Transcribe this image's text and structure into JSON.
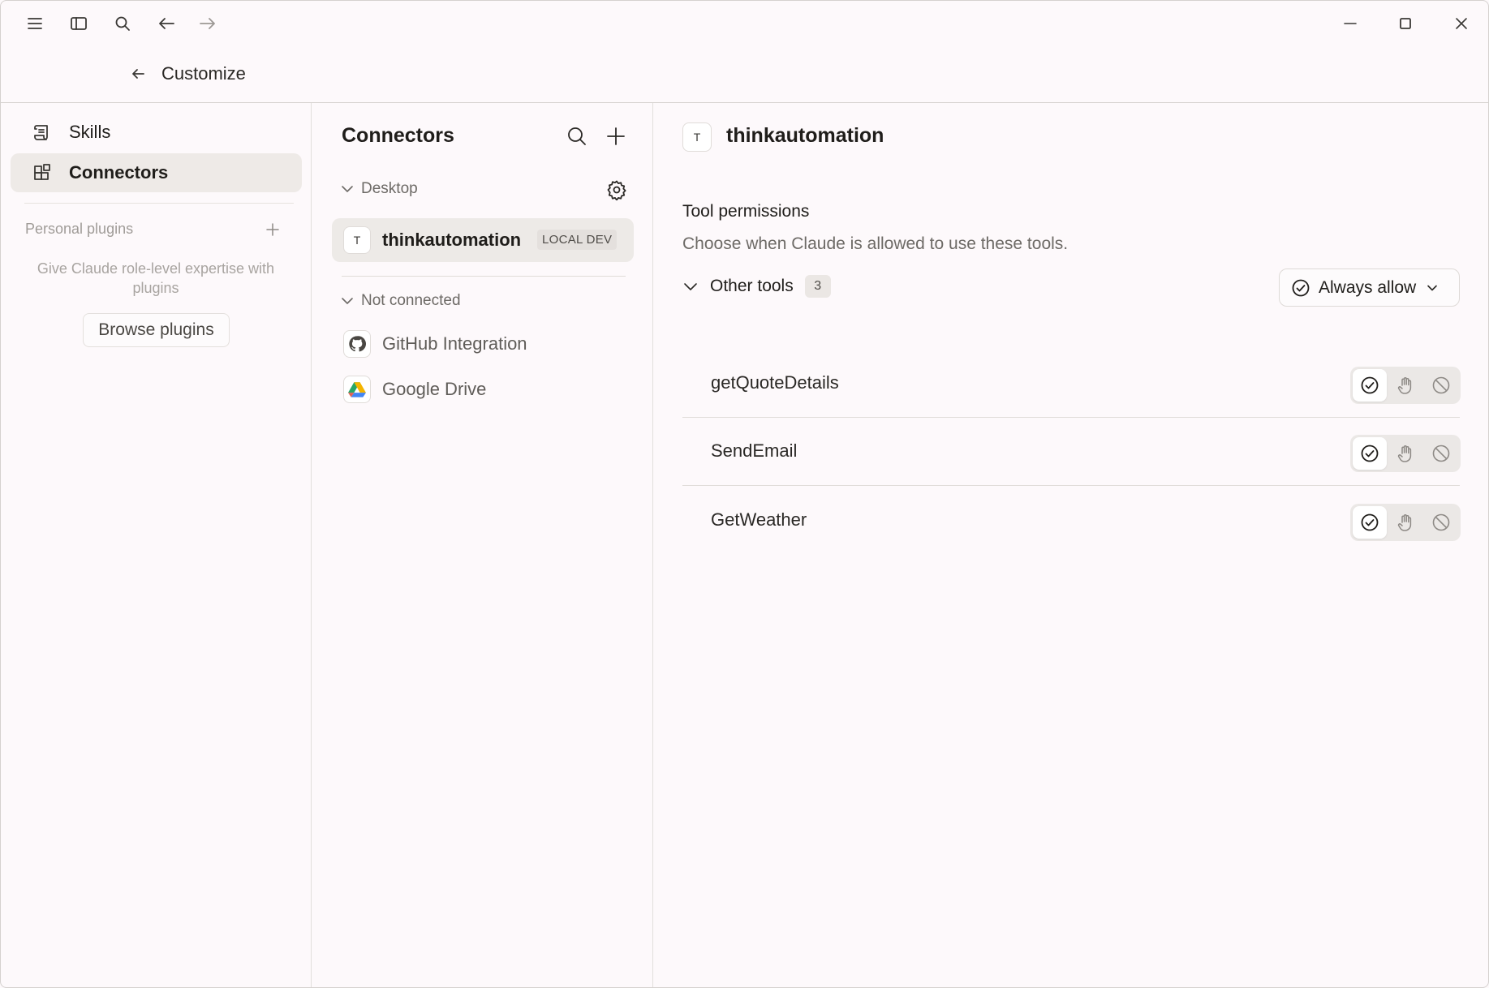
{
  "header": {
    "title": "Customize"
  },
  "sidebar": {
    "items": [
      {
        "label": "Skills",
        "icon": "scroll-icon",
        "active": false
      },
      {
        "label": "Connectors",
        "icon": "blocks-icon",
        "active": true
      }
    ],
    "plugins_label": "Personal plugins",
    "plugins_description": "Give Claude role-level expertise with plugins",
    "browse_label": "Browse plugins"
  },
  "connectors": {
    "title": "Connectors",
    "groups": [
      {
        "label": "Desktop",
        "items": [
          {
            "name": "thinkautomation",
            "initial": "T",
            "badge": "LOCAL DEV",
            "active": true
          }
        ]
      },
      {
        "label": "Not connected",
        "items": [
          {
            "name": "GitHub Integration",
            "icon": "github-icon"
          },
          {
            "name": "Google Drive",
            "icon": "google-drive-icon"
          }
        ]
      }
    ]
  },
  "detail": {
    "initial": "T",
    "title": "thinkautomation",
    "section_title": "Tool permissions",
    "section_desc": "Choose when Claude is allowed to use these tools.",
    "group_label": "Other tools",
    "group_count": "3",
    "dropdown_label": "Always allow",
    "tools": [
      {
        "name": "getQuoteDetails",
        "permission": "allow"
      },
      {
        "name": "SendEmail",
        "permission": "allow"
      },
      {
        "name": "GetWeather",
        "permission": "allow"
      }
    ]
  }
}
